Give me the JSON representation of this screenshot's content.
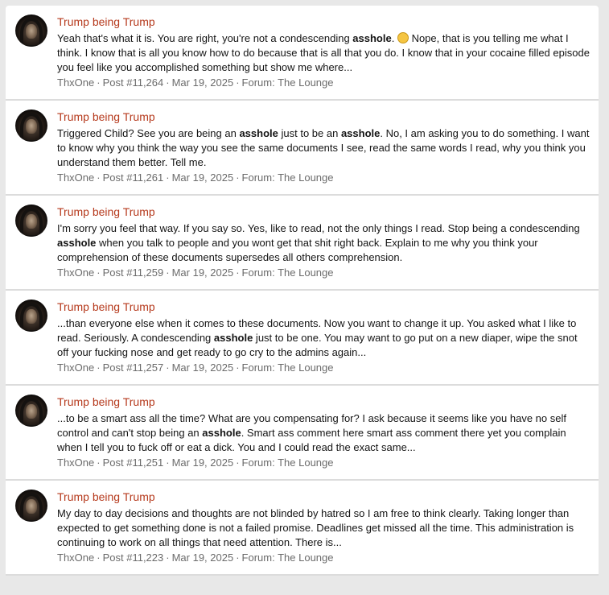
{
  "results": [
    {
      "title": "Trump being Trump",
      "snippet_html": "Yeah that's what it is. You are right, you're not a condescending <b>asshole</b>. <span class=\"emoji\" data-name=\"emoji-icon\" data-interactable=\"false\"></span> Nope, that is you telling me what I think. I know that is all you know how to do because that is all that you do. I know that in your cocaine filled episode you feel like you accomplished something but show me where...",
      "author": "ThxOne",
      "post": "Post #11,264",
      "date": "Mar 19, 2025",
      "forum_label": "Forum:",
      "forum": "The Lounge"
    },
    {
      "title": "Trump being Trump",
      "snippet_html": "Triggered Child? See you are being an <b>asshole</b> just to be an <b>asshole</b>. No, I am asking you to do something. I want to know why you think the way you see the same documents I see, read the same words I read, why you think you understand them better. Tell me.",
      "author": "ThxOne",
      "post": "Post #11,261",
      "date": "Mar 19, 2025",
      "forum_label": "Forum:",
      "forum": "The Lounge"
    },
    {
      "title": "Trump being Trump",
      "snippet_html": "I'm sorry you feel that way. If you say so. Yes, like to read, not the only things I read. Stop being a condescending <b>asshole</b> when you talk to people and you wont get that shit right back. Explain to me why you think your comprehension of these documents supersedes all others comprehension.",
      "author": "ThxOne",
      "post": "Post #11,259",
      "date": "Mar 19, 2025",
      "forum_label": "Forum:",
      "forum": "The Lounge"
    },
    {
      "title": "Trump being Trump",
      "snippet_html": "...than everyone else when it comes to these documents. Now you want to change it up. You asked what I like to read. Seriously. A condescending <b>asshole</b> just to be one. You may want to go put on a new diaper, wipe the snot off your fucking nose and get ready to go cry to the admins again...",
      "author": "ThxOne",
      "post": "Post #11,257",
      "date": "Mar 19, 2025",
      "forum_label": "Forum:",
      "forum": "The Lounge"
    },
    {
      "title": "Trump being Trump",
      "snippet_html": "...to be a smart ass all the time? What are you compensating for? I ask because it seems like you have no self control and can't stop being an <b>asshole</b>. Smart ass comment here smart ass comment there yet you complain when I tell you to fuck off or eat a dick. You and I could read the exact same...",
      "author": "ThxOne",
      "post": "Post #11,251",
      "date": "Mar 19, 2025",
      "forum_label": "Forum:",
      "forum": "The Lounge"
    },
    {
      "title": "Trump being Trump",
      "snippet_html": "My day to day decisions and thoughts are not blinded by hatred so I am free to think clearly. Taking longer than expected to get something done is not a failed promise. Deadlines get missed all the time. This administration is continuing to work on all things that need attention. There is...",
      "author": "ThxOne",
      "post": "Post #11,223",
      "date": "Mar 19, 2025",
      "forum_label": "Forum:",
      "forum": "The Lounge"
    }
  ]
}
